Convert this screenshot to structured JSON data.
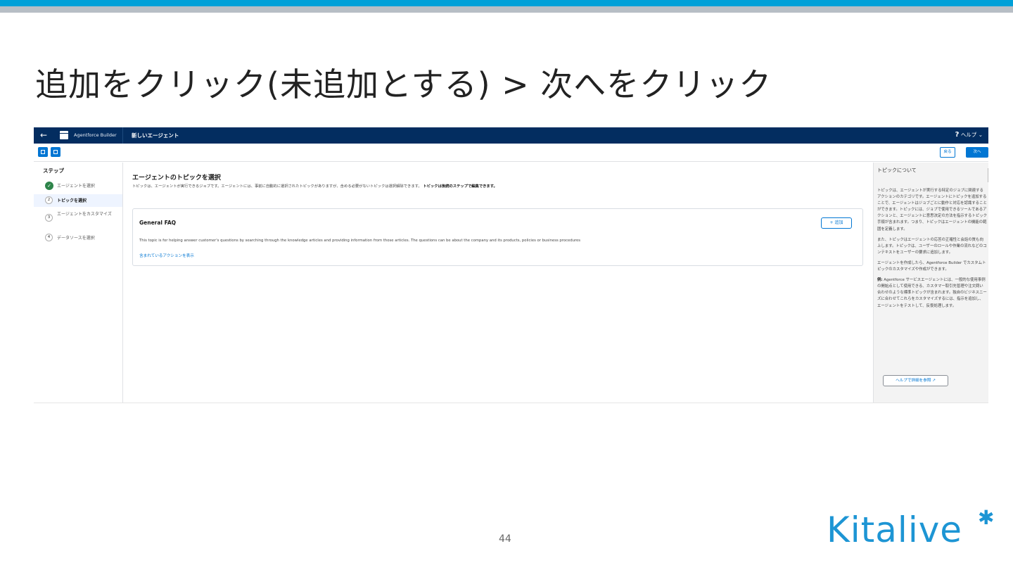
{
  "slide": {
    "title": "追加をクリック(未追加とする) > 次へをクリック",
    "page_number": "44",
    "logo_text": "Kitalive"
  },
  "app": {
    "back_icon": "←",
    "app_name": "Agentforce Builder",
    "agent_name": "新しいエージェント",
    "help_icon": "?",
    "help_label": "ヘルプ",
    "help_chevron": "⌄"
  },
  "toolbar": {
    "back_button": "戻る",
    "next_button": "次へ"
  },
  "steps": {
    "title": "ステップ",
    "items": [
      {
        "marker": "✓",
        "label": "エージェントを選択"
      },
      {
        "marker": "2",
        "label": "トピックを選択"
      },
      {
        "marker": "3",
        "label": "エージェントをカスタマイズ"
      },
      {
        "marker": "4",
        "label": "データソースを選択"
      }
    ]
  },
  "main": {
    "title": "エージェントのトピックを選択",
    "description": "トピックは、エージェントが実行できるジョブです。エージェントには、事前に自動的に選択されたトピックがありますが、含める必要がないトピックは選択解除できます。",
    "description_bold": "トピックは後続のステップで編集できます。",
    "topic": {
      "name": "General FAQ",
      "add_button": "+ 追加",
      "description": "This topic is for helping answer customer's questions by searching through the knowledge articles and providing information from those articles. The questions can be about the company and its products, policies or business procedures",
      "actions_link": "含まれているアクションを表示"
    }
  },
  "side_panel": {
    "title": "トピックについて",
    "paragraphs": [
      "トピックは、エージェントが実行する特定のジョブに関連するアクションのカテゴリです。エージェントにトピックを追加することで、エージェントはジョブごとに動作と対応を認識することができます。トピックには、ジョブで使用できるツールであるアクションと、エージェントに意思決定の方法を指示するトピック手順が含まれます。つまり、トピックはエージェントの機能の範囲を定義します。",
      "また、トピックはエージェントの応答の正確性と会話の質も向上します。トピックは、ユーザーのロールや作業の流れなどのコンテキストをユーザーの要求に追加します。",
      "エージェントを作成したら、Agentforce Builder でカスタムトピックのカスタマイズや作成ができます。"
    ],
    "example_label": "例:",
    "example_text": "Agentforce サービスエージェントには、一般的な使用事例の開始点として使用できる、カスタマー取引先管理や注文問い合わせのような標準トピックが含まれます。独自のビジネスニーズに合わせてこれらをカスタマイズするには、指示を追加し、エージェントをテストして、反復処理します。",
    "help_button": "ヘルプで詳細を参照",
    "help_button_icon": "external-link-icon"
  }
}
